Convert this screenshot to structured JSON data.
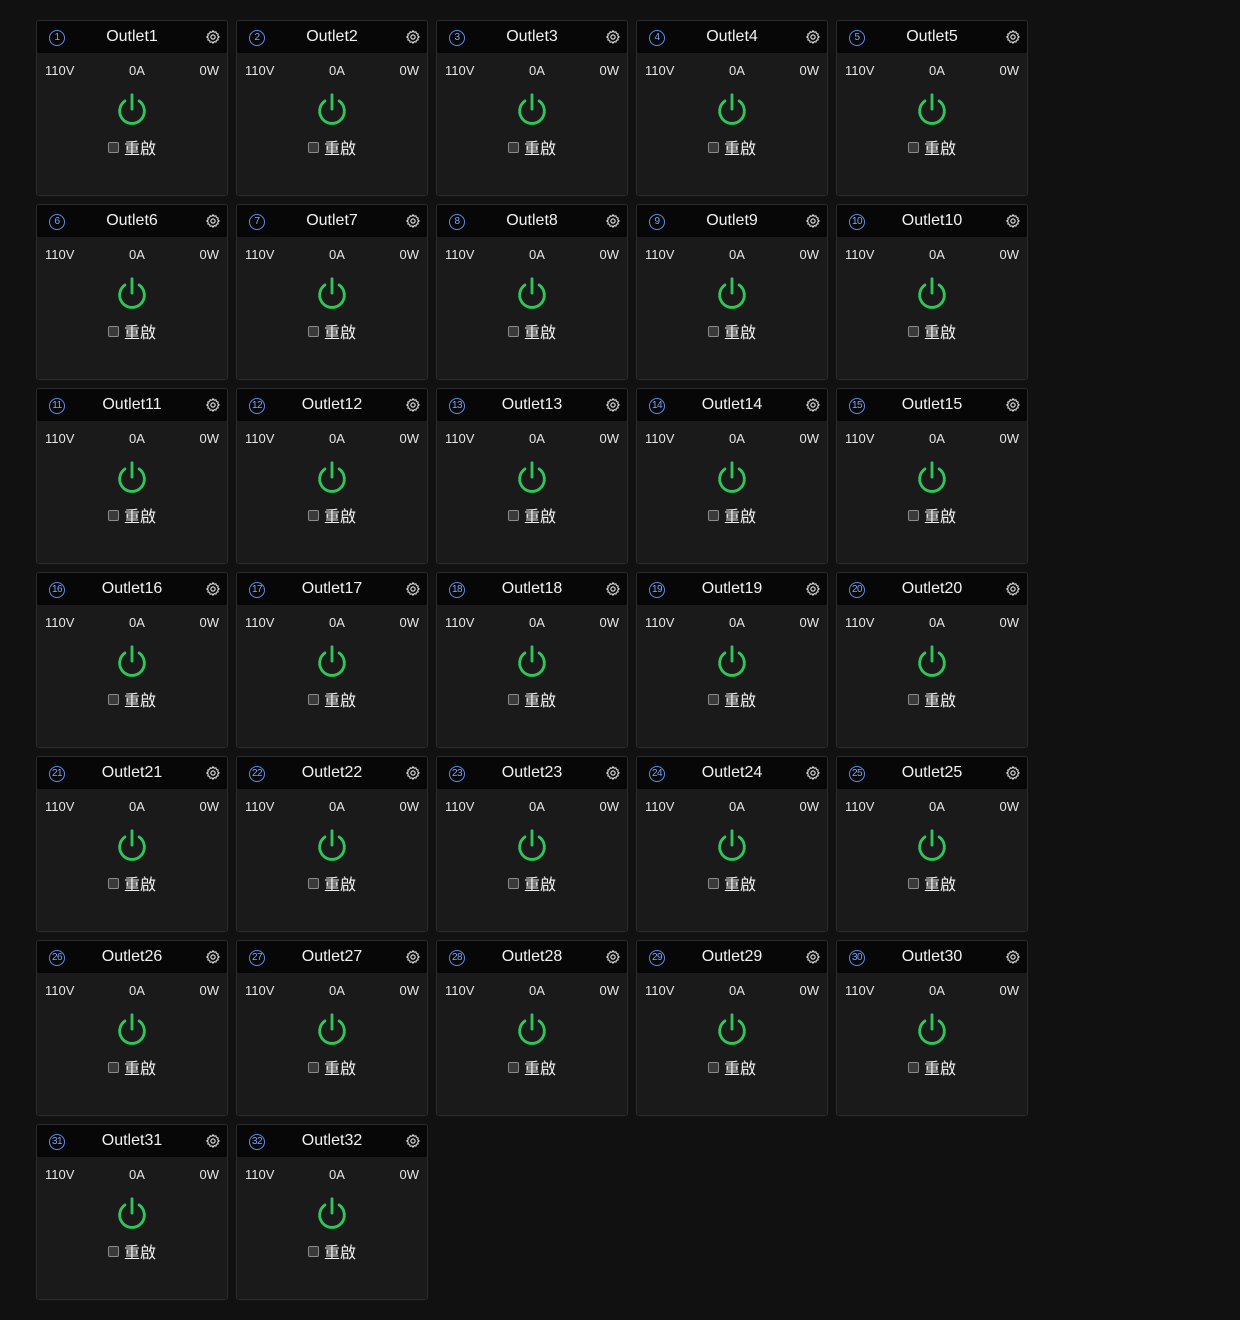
{
  "colors": {
    "background": "#111112",
    "card": "#1a1a1b",
    "header": "#070707",
    "power_on": "#2fc75a",
    "badge": "#5b8def"
  },
  "icons": {
    "settings": "gear-icon",
    "power": "power-icon"
  },
  "outlets": [
    {
      "number": "1",
      "name": "Outlet1",
      "voltage": "110V",
      "current": "0A",
      "power": "0W",
      "reboot_label": "重啟",
      "reboot_checked": false,
      "state": "on"
    },
    {
      "number": "2",
      "name": "Outlet2",
      "voltage": "110V",
      "current": "0A",
      "power": "0W",
      "reboot_label": "重啟",
      "reboot_checked": false,
      "state": "on"
    },
    {
      "number": "3",
      "name": "Outlet3",
      "voltage": "110V",
      "current": "0A",
      "power": "0W",
      "reboot_label": "重啟",
      "reboot_checked": false,
      "state": "on"
    },
    {
      "number": "4",
      "name": "Outlet4",
      "voltage": "110V",
      "current": "0A",
      "power": "0W",
      "reboot_label": "重啟",
      "reboot_checked": false,
      "state": "on"
    },
    {
      "number": "5",
      "name": "Outlet5",
      "voltage": "110V",
      "current": "0A",
      "power": "0W",
      "reboot_label": "重啟",
      "reboot_checked": false,
      "state": "on"
    },
    {
      "number": "6",
      "name": "Outlet6",
      "voltage": "110V",
      "current": "0A",
      "power": "0W",
      "reboot_label": "重啟",
      "reboot_checked": false,
      "state": "on"
    },
    {
      "number": "7",
      "name": "Outlet7",
      "voltage": "110V",
      "current": "0A",
      "power": "0W",
      "reboot_label": "重啟",
      "reboot_checked": false,
      "state": "on"
    },
    {
      "number": "8",
      "name": "Outlet8",
      "voltage": "110V",
      "current": "0A",
      "power": "0W",
      "reboot_label": "重啟",
      "reboot_checked": false,
      "state": "on"
    },
    {
      "number": "9",
      "name": "Outlet9",
      "voltage": "110V",
      "current": "0A",
      "power": "0W",
      "reboot_label": "重啟",
      "reboot_checked": false,
      "state": "on"
    },
    {
      "number": "10",
      "name": "Outlet10",
      "voltage": "110V",
      "current": "0A",
      "power": "0W",
      "reboot_label": "重啟",
      "reboot_checked": false,
      "state": "on"
    },
    {
      "number": "11",
      "name": "Outlet11",
      "voltage": "110V",
      "current": "0A",
      "power": "0W",
      "reboot_label": "重啟",
      "reboot_checked": false,
      "state": "on"
    },
    {
      "number": "12",
      "name": "Outlet12",
      "voltage": "110V",
      "current": "0A",
      "power": "0W",
      "reboot_label": "重啟",
      "reboot_checked": false,
      "state": "on"
    },
    {
      "number": "13",
      "name": "Outlet13",
      "voltage": "110V",
      "current": "0A",
      "power": "0W",
      "reboot_label": "重啟",
      "reboot_checked": false,
      "state": "on"
    },
    {
      "number": "14",
      "name": "Outlet14",
      "voltage": "110V",
      "current": "0A",
      "power": "0W",
      "reboot_label": "重啟",
      "reboot_checked": false,
      "state": "on"
    },
    {
      "number": "15",
      "name": "Outlet15",
      "voltage": "110V",
      "current": "0A",
      "power": "0W",
      "reboot_label": "重啟",
      "reboot_checked": false,
      "state": "on"
    },
    {
      "number": "16",
      "name": "Outlet16",
      "voltage": "110V",
      "current": "0A",
      "power": "0W",
      "reboot_label": "重啟",
      "reboot_checked": false,
      "state": "on"
    },
    {
      "number": "17",
      "name": "Outlet17",
      "voltage": "110V",
      "current": "0A",
      "power": "0W",
      "reboot_label": "重啟",
      "reboot_checked": false,
      "state": "on"
    },
    {
      "number": "18",
      "name": "Outlet18",
      "voltage": "110V",
      "current": "0A",
      "power": "0W",
      "reboot_label": "重啟",
      "reboot_checked": false,
      "state": "on"
    },
    {
      "number": "19",
      "name": "Outlet19",
      "voltage": "110V",
      "current": "0A",
      "power": "0W",
      "reboot_label": "重啟",
      "reboot_checked": false,
      "state": "on"
    },
    {
      "number": "20",
      "name": "Outlet20",
      "voltage": "110V",
      "current": "0A",
      "power": "0W",
      "reboot_label": "重啟",
      "reboot_checked": false,
      "state": "on"
    },
    {
      "number": "21",
      "name": "Outlet21",
      "voltage": "110V",
      "current": "0A",
      "power": "0W",
      "reboot_label": "重啟",
      "reboot_checked": false,
      "state": "on"
    },
    {
      "number": "22",
      "name": "Outlet22",
      "voltage": "110V",
      "current": "0A",
      "power": "0W",
      "reboot_label": "重啟",
      "reboot_checked": false,
      "state": "on"
    },
    {
      "number": "23",
      "name": "Outlet23",
      "voltage": "110V",
      "current": "0A",
      "power": "0W",
      "reboot_label": "重啟",
      "reboot_checked": false,
      "state": "on"
    },
    {
      "number": "24",
      "name": "Outlet24",
      "voltage": "110V",
      "current": "0A",
      "power": "0W",
      "reboot_label": "重啟",
      "reboot_checked": false,
      "state": "on"
    },
    {
      "number": "25",
      "name": "Outlet25",
      "voltage": "110V",
      "current": "0A",
      "power": "0W",
      "reboot_label": "重啟",
      "reboot_checked": false,
      "state": "on"
    },
    {
      "number": "26",
      "name": "Outlet26",
      "voltage": "110V",
      "current": "0A",
      "power": "0W",
      "reboot_label": "重啟",
      "reboot_checked": false,
      "state": "on"
    },
    {
      "number": "27",
      "name": "Outlet27",
      "voltage": "110V",
      "current": "0A",
      "power": "0W",
      "reboot_label": "重啟",
      "reboot_checked": false,
      "state": "on"
    },
    {
      "number": "28",
      "name": "Outlet28",
      "voltage": "110V",
      "current": "0A",
      "power": "0W",
      "reboot_label": "重啟",
      "reboot_checked": false,
      "state": "on"
    },
    {
      "number": "29",
      "name": "Outlet29",
      "voltage": "110V",
      "current": "0A",
      "power": "0W",
      "reboot_label": "重啟",
      "reboot_checked": false,
      "state": "on"
    },
    {
      "number": "30",
      "name": "Outlet30",
      "voltage": "110V",
      "current": "0A",
      "power": "0W",
      "reboot_label": "重啟",
      "reboot_checked": false,
      "state": "on"
    },
    {
      "number": "31",
      "name": "Outlet31",
      "voltage": "110V",
      "current": "0A",
      "power": "0W",
      "reboot_label": "重啟",
      "reboot_checked": false,
      "state": "on"
    },
    {
      "number": "32",
      "name": "Outlet32",
      "voltage": "110V",
      "current": "0A",
      "power": "0W",
      "reboot_label": "重啟",
      "reboot_checked": false,
      "state": "on"
    }
  ]
}
